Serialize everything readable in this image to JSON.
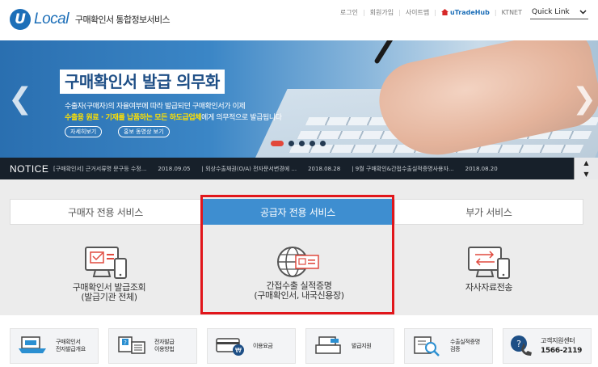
{
  "header": {
    "logo_letter": "U",
    "logo_text": "Local",
    "logo_sub": "구매확인서 통합정보서비스",
    "nav": [
      "로그인",
      "회원가입",
      "사이트맵"
    ],
    "utradehub": "uTradeHub",
    "ktnet": "KTNET",
    "quick_link": "Quick Link"
  },
  "banner": {
    "title": "구매확인서 발급 의무화",
    "line1": "수출자(구매자)의 자율여부에 따라 발급되던 구매확인서가 이제",
    "line2_highlight": "수출용 원료 · 기재를 납품하는 모든 하도급업체",
    "line2_rest": "에게 의무적으로 발급됩니다",
    "btn_detail": "자세히보기",
    "btn_video": "홍보 동영상 보기",
    "slide_count": 5,
    "active_slide": 1
  },
  "notice": {
    "label": "NOTICE",
    "items": [
      {
        "text": "[구매확인서] 근거서류명 문구등 수정...",
        "date": "2018.09.05"
      },
      {
        "text": "| 외상수출채권(O/A) 전자문서변경에 ...",
        "date": "2018.08.28"
      },
      {
        "text": "| 9월 구매확인&간접수출실적증명사용자...",
        "date": "2018.08.20"
      }
    ],
    "up": "▲",
    "down": "▼"
  },
  "services": {
    "tabs": [
      "구매자 전용 서비스",
      "공급자 전용 서비스",
      "부가 서비스"
    ],
    "active_tab": 1,
    "items": [
      {
        "line1": "구매확인서 발급조회",
        "line2": "(발급기관 전체)"
      },
      {
        "line1": "간접수출 실적증명",
        "line2": "(구매확인서, 내국신용장)"
      },
      {
        "line1": "자사자료전송",
        "line2": ""
      }
    ]
  },
  "quick_links": [
    {
      "line1": "구매확인서",
      "line2": "전자발급개요"
    },
    {
      "line1": "전자발급",
      "line2": "이용방법"
    },
    {
      "line1": "이용요금",
      "line2": ""
    },
    {
      "line1": "발급지원",
      "line2": ""
    },
    {
      "line1": "수출실적증명",
      "line2": "검증"
    },
    {
      "line1": "고객지원센터",
      "line2": "1566-2119"
    }
  ],
  "colors": {
    "brand": "#1d6fb8",
    "active_tab": "#3e8ed0",
    "highlight": "#e1161b",
    "notice_bg": "#17202a",
    "banner_highlight": "#ffe100"
  }
}
